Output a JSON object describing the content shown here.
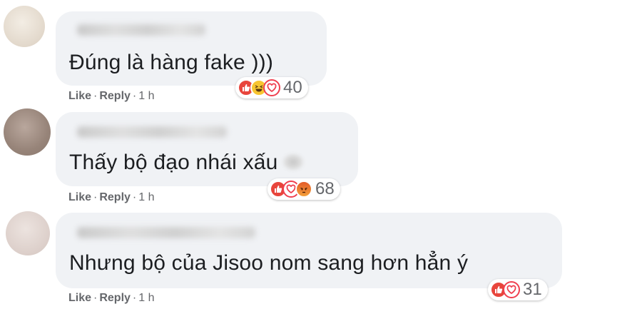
{
  "comments": [
    {
      "text": "Đúng là hàng fake )))",
      "actions": {
        "like": "Like",
        "reply": "Reply",
        "sep": "·",
        "time": "1 h"
      },
      "reactions": {
        "icons": [
          "like-icon",
          "haha-icon",
          "love-icon"
        ],
        "count": "40"
      }
    },
    {
      "text": "Thấy bộ đạo nhái xấu",
      "actions": {
        "like": "Like",
        "reply": "Reply",
        "sep": "·",
        "time": "1 h"
      },
      "reactions": {
        "icons": [
          "like-icon",
          "love-icon",
          "angry-icon"
        ],
        "count": "68"
      }
    },
    {
      "text": "Nhưng bộ của Jisoo nom sang hơn hẳn ý",
      "actions": {
        "like": "Like",
        "reply": "Reply",
        "sep": "·",
        "time": "1 h"
      },
      "reactions": {
        "icons": [
          "like-icon",
          "love-icon"
        ],
        "count": "31"
      }
    }
  ],
  "colors": {
    "bubble": "#f0f2f5",
    "text": "#1c1e21",
    "meta": "#65676b",
    "like": "#e8453c",
    "love": "#ef4050",
    "haha": "#f7c531",
    "angry": "#e35b2a"
  }
}
